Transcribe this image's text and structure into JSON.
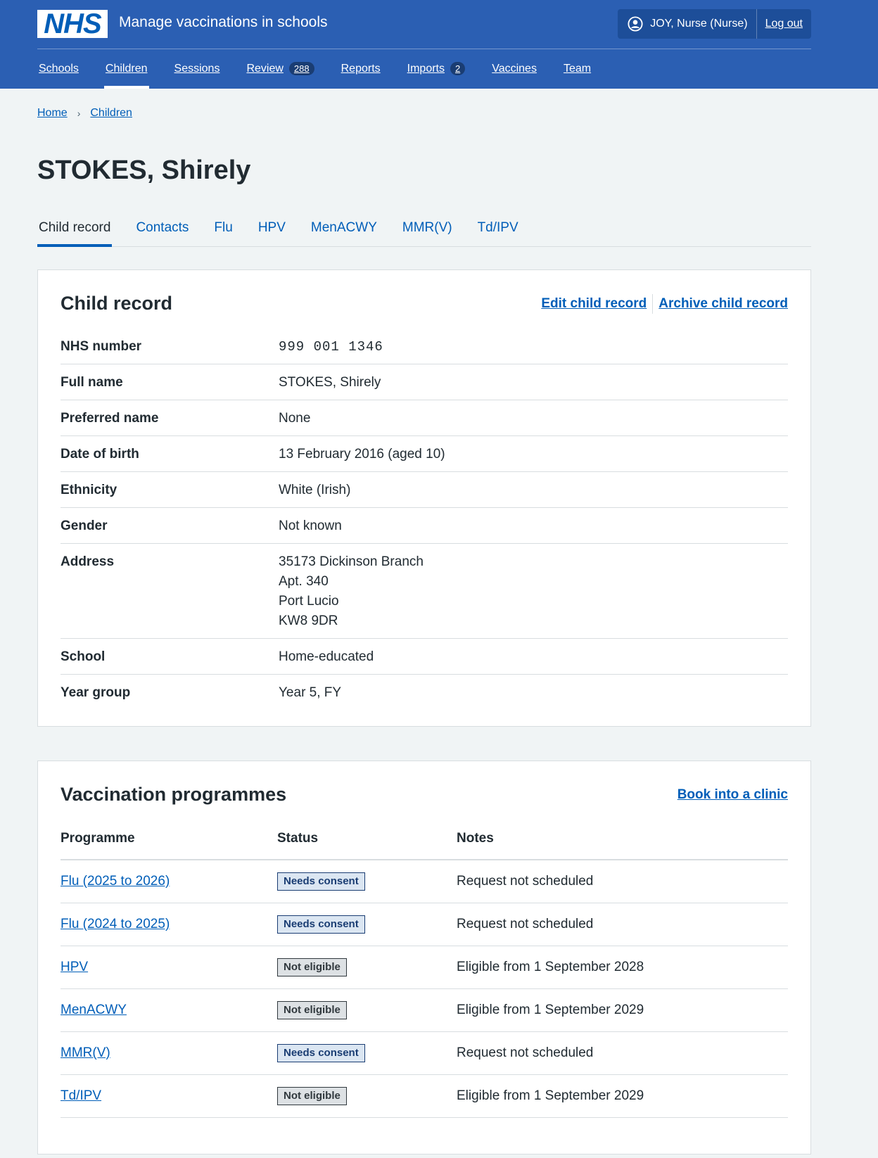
{
  "header": {
    "logo_text": "NHS",
    "service_name": "Manage vaccinations in schools",
    "user": "JOY, Nurse (Nurse)",
    "logout": "Log out",
    "nav": [
      {
        "label": "Schools"
      },
      {
        "label": "Children"
      },
      {
        "label": "Sessions"
      },
      {
        "label": "Review",
        "count": "288"
      },
      {
        "label": "Reports"
      },
      {
        "label": "Imports",
        "count": "2"
      },
      {
        "label": "Vaccines"
      },
      {
        "label": "Team"
      }
    ]
  },
  "breadcrumb": [
    "Home",
    "Children"
  ],
  "page_title": "STOKES, Shirely",
  "tabs": [
    "Child record",
    "Contacts",
    "Flu",
    "HPV",
    "MenACWY",
    "MMR(V)",
    "Td/IPV"
  ],
  "child_record": {
    "title": "Child record",
    "edit": "Edit child record",
    "archive": "Archive child record",
    "rows": [
      {
        "key": "NHS number",
        "value": "999 001 1346"
      },
      {
        "key": "Full name",
        "value": "STOKES, Shirely"
      },
      {
        "key": "Preferred name",
        "value": "None"
      },
      {
        "key": "Date of birth",
        "value": "13 February 2016 (aged 10)"
      },
      {
        "key": "Ethnicity",
        "value": "White (Irish)"
      },
      {
        "key": "Gender",
        "value": "Not known"
      },
      {
        "key": "Address",
        "lines": [
          "35173 Dickinson Branch",
          "Apt. 340",
          "Port Lucio",
          "KW8 9DR"
        ]
      },
      {
        "key": "School",
        "value": "Home-educated"
      },
      {
        "key": "Year group",
        "value": "Year 5, FY"
      }
    ]
  },
  "programmes": {
    "title": "Vaccination programmes",
    "action": "Book into a clinic",
    "headers": [
      "Programme",
      "Status",
      "Notes"
    ],
    "rows": [
      {
        "programme": "Flu (2025 to 2026)",
        "status": "Needs consent",
        "notes": "Request not scheduled"
      },
      {
        "programme": "Flu (2024 to 2025)",
        "status": "Needs consent",
        "notes": "Request not scheduled"
      },
      {
        "programme": "HPV",
        "status": "Not eligible",
        "notes": "Eligible from 1 September 2028"
      },
      {
        "programme": "MenACWY",
        "status": "Not eligible",
        "notes": "Eligible from 1 September 2029"
      },
      {
        "programme": "MMR(V)",
        "status": "Needs consent",
        "notes": "Request not scheduled"
      },
      {
        "programme": "Td/IPV",
        "status": "Not eligible",
        "notes": "Eligible from 1 September 2029"
      }
    ]
  },
  "colors": {
    "header_bg": "#2b5fb3",
    "link": "#005eb8",
    "tag_blue_bg": "#dbe6f2",
    "tag_grey_bg": "#dde1e4"
  }
}
